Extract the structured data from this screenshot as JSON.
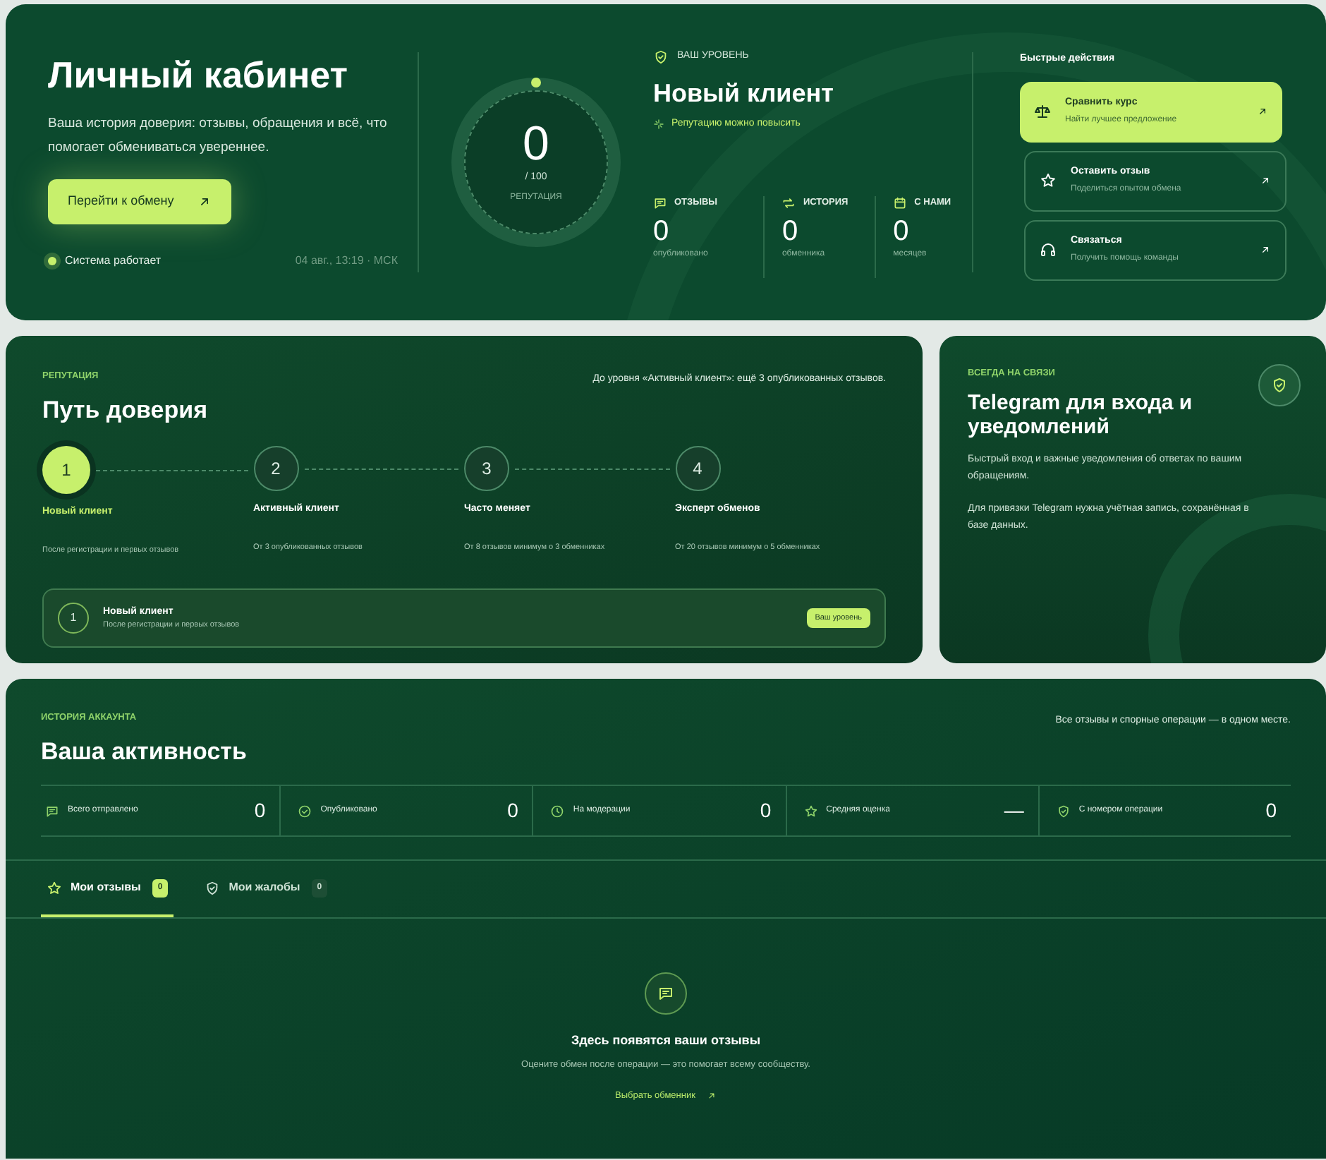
{
  "hero": {
    "title": "Личный кабинет",
    "subtitle": "Ваша история доверия: отзывы, обращения и всё, что помогает обмениваться увереннее.",
    "cta": "Перейти к обмену",
    "status": "Система работает",
    "status_ok": true,
    "timestamp": "04 авг., 13:19 · МСК",
    "score": {
      "value": "0",
      "max": "/ 100",
      "label": "РЕПУТАЦИЯ"
    },
    "level": {
      "caption": "ВАШ УРОВЕНЬ",
      "name": "Новый клиент",
      "hint": "Репутацию можно повысить"
    },
    "stats": [
      {
        "kind": "reviews",
        "label": "ОТЗЫВЫ",
        "value": "0",
        "note": "опубликовано"
      },
      {
        "kind": "history",
        "label": "ИСТОРИЯ",
        "value": "0",
        "note": "обменника"
      },
      {
        "kind": "calendar",
        "label": "С НАМИ",
        "value": "0",
        "note": "месяцев"
      }
    ],
    "quick_actions_title": "Быстрые действия",
    "quick_actions": [
      {
        "kind": "scales",
        "title": "Сравнить курс",
        "subtitle": "Найти лучшее предложение",
        "highlighted": true
      },
      {
        "kind": "star",
        "title": "Оставить отзыв",
        "subtitle": "Поделиться опытом обмена",
        "highlighted": false
      },
      {
        "kind": "headset",
        "title": "Связаться",
        "subtitle": "Получить помощь команды",
        "highlighted": false
      }
    ]
  },
  "trust": {
    "eyebrow": "РЕПУТАЦИЯ",
    "title": "Путь доверия",
    "next_hint": "До уровня «Активный клиент»: ещё 3 опубликованных отзывов.",
    "steps": [
      {
        "number": "1",
        "name": "Новый клиент",
        "requirement": "После регистрации и первых отзывов",
        "selected": true
      },
      {
        "number": "2",
        "name": "Активный клиент",
        "requirement": "От 3 опубликованных отзывов",
        "selected": false
      },
      {
        "number": "3",
        "name": "Часто меняет",
        "requirement": "От 8 отзывов минимум о 3 обменниках",
        "selected": false
      },
      {
        "number": "4",
        "name": "Эксперт обменов",
        "requirement": "От 20 отзывов минимум о 5 обменниках",
        "selected": false
      }
    ],
    "current": {
      "number": "1",
      "name": "Новый клиент",
      "requirement": "После регистрации и первых отзывов",
      "badge": "Ваш уровень"
    }
  },
  "telegram": {
    "eyebrow": "ВСЕГДА НА СВЯЗИ",
    "title": "Telegram для входа и уведомлений",
    "paragraphs": [
      "Быстрый вход и важные уведомления об ответах по вашим обращениям.",
      "Для привязки Telegram нужна учётная запись, сохранённая в базе данных."
    ]
  },
  "activity": {
    "eyebrow": "ИСТОРИЯ АККАУНТА",
    "title": "Ваша активность",
    "note": "Все отзывы и спорные операции — в одном месте.",
    "metrics": [
      {
        "kind": "chat",
        "label": "Всего отправлено",
        "value": "0"
      },
      {
        "kind": "check",
        "label": "Опубликовано",
        "value": "0"
      },
      {
        "kind": "clock",
        "label": "На модерации",
        "value": "0"
      },
      {
        "kind": "star",
        "label": "Средняя оценка",
        "value": "—"
      },
      {
        "kind": "shield",
        "label": "С номером операции",
        "value": "0"
      }
    ],
    "tabs": [
      {
        "kind": "star",
        "label": "Мои отзывы",
        "count": "0",
        "selected": true
      },
      {
        "kind": "shield",
        "label": "Мои жалобы",
        "count": "0",
        "selected": false
      }
    ],
    "empty": {
      "title": "Здесь появятся ваши отзывы",
      "text": "Оцените обмен после операции — это помогает всему сообществу.",
      "link": "Выбрать обменник"
    }
  }
}
